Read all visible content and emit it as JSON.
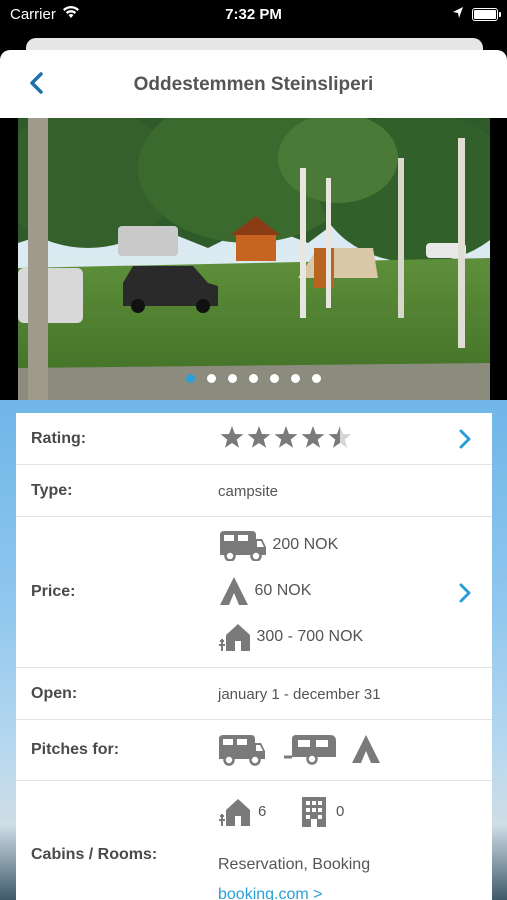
{
  "status_bar": {
    "carrier": "Carrier",
    "time": "7:32 PM"
  },
  "header": {
    "title": "Oddestemmen Steinsliperi"
  },
  "gallery": {
    "dot_count": 7,
    "active_index": 0
  },
  "details": {
    "rating": {
      "label": "Rating:",
      "stars": 4.5,
      "max": 5
    },
    "type": {
      "label": "Type:",
      "value": "campsite"
    },
    "price": {
      "label": "Price:",
      "motorhome": "200 NOK",
      "tent": "60 NOK",
      "cabin": "300 - 700 NOK"
    },
    "open": {
      "label": "Open:",
      "value": "january 1 - december 31"
    },
    "pitches": {
      "label": "Pitches for:",
      "icons": [
        "motorhome-icon",
        "caravan-icon",
        "tent-icon"
      ]
    },
    "cabins": {
      "label": "Cabins / Rooms:",
      "cabins_count": "6",
      "rooms_count": "0",
      "reservation": "Reservation, Booking",
      "link": "booking.com >"
    }
  },
  "colors": {
    "accent": "#2a9fd8",
    "icon_gray": "#7a7a7a"
  }
}
